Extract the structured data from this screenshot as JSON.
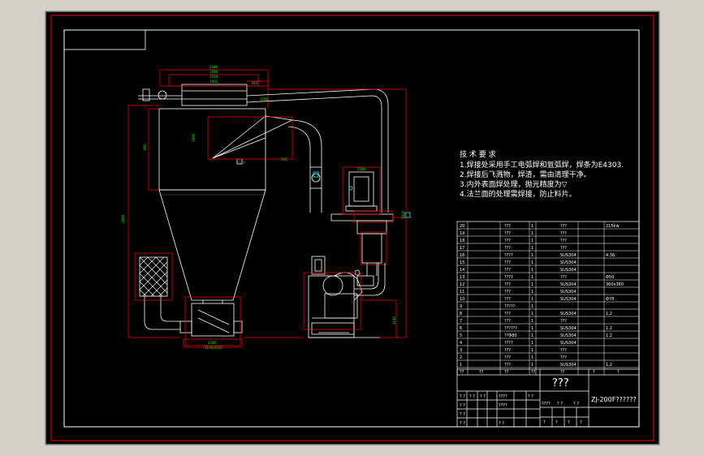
{
  "colors": {
    "frame_bg": "#d4d0c8",
    "canvas": "#000000",
    "outer_border": "#ff0000",
    "drawing_lines": "#ffffff",
    "dimension_lines": "#ff0000",
    "dimension_text": "#00ff00",
    "accent_cyan": "#00ffff"
  },
  "tech_requirements": {
    "heading": "技 术 要 求",
    "items": [
      "1.焊接处采用手工电弧焊和氩弧焊，焊条为E4303.",
      "2.焊接后飞溅物，焊渣，需由清理干净。",
      "3.内外表面焊处理，抛光精度为▽",
      "4.法兰面的处理需焊接，防止料片。"
    ]
  },
  "parts_table": {
    "rows": [
      {
        "no": "20",
        "code": "???",
        "name": "1",
        "material": "???",
        "note": "215kw"
      },
      {
        "no": "19",
        "code": "???",
        "name": "1",
        "material": "???",
        "note": ""
      },
      {
        "no": "18",
        "code": "???",
        "name": "1",
        "material": "???",
        "note": ""
      },
      {
        "no": "17",
        "code": "???",
        "name": "1",
        "material": "???",
        "note": ""
      },
      {
        "no": "16",
        "code": "????",
        "name": "1",
        "material": "SUS304",
        "note": "4.36"
      },
      {
        "no": "15",
        "code": "???",
        "name": "1",
        "material": "SUS304",
        "note": ""
      },
      {
        "no": "14",
        "code": "???",
        "name": "1",
        "material": "SUS304",
        "note": ""
      },
      {
        "no": "13",
        "code": "????",
        "name": "1",
        "material": "???",
        "note": "Φ50"
      },
      {
        "no": "12",
        "code": "???",
        "name": "1",
        "material": "SUS304",
        "note": "360x360"
      },
      {
        "no": "11",
        "code": "???",
        "name": "1",
        "material": "SUS304",
        "note": ""
      },
      {
        "no": "10",
        "code": "???",
        "name": "1",
        "material": "SUS304",
        "note": "Φ78"
      },
      {
        "no": "9",
        "code": "?????",
        "name": "1",
        "material": "",
        "note": ""
      },
      {
        "no": "8",
        "code": "???",
        "name": "1",
        "material": "SUS304",
        "note": "1.2"
      },
      {
        "no": "7",
        "code": "???",
        "name": "1",
        "material": "???",
        "note": ""
      },
      {
        "no": "6",
        "code": "??????",
        "name": "1",
        "material": "SUS304",
        "note": "1.2"
      },
      {
        "no": "5",
        "code": "??Φ80",
        "name": "1",
        "material": "SUS304",
        "note": "1.2"
      },
      {
        "no": "4",
        "code": "????",
        "name": "1",
        "material": "SUS304",
        "note": ""
      },
      {
        "no": "3",
        "code": "???",
        "name": "1",
        "material": "???",
        "note": ""
      },
      {
        "no": "2",
        "code": "???",
        "name": "1",
        "material": "???",
        "note": ""
      },
      {
        "no": "1",
        "code": "???",
        "name": "1",
        "material": "SUS304",
        "note": "1.2"
      }
    ],
    "header_row": [
      "??",
      "??",
      "??",
      "??",
      "??",
      "?",
      "?"
    ]
  },
  "title_block": {
    "drawing_title": "???",
    "drawing_code": "ZJ-200F??????",
    "sign_rows": [
      [
        "? ?",
        "? ?",
        "? ?",
        "????",
        "? ?"
      ],
      [
        "? ?",
        "",
        "????",
        ""
      ],
      [
        "? ?",
        "",
        "",
        ""
      ],
      [
        "? ?",
        "",
        "? ?",
        ""
      ]
    ],
    "scale_labels": [
      "????",
      "? ?",
      "? ?"
    ],
    "sheet_labels": [
      "?",
      "?",
      "?",
      "?",
      "?"
    ]
  },
  "dimension_labels": {
    "top_stack": [
      "2346",
      "1910",
      "1504",
      "1002"
    ],
    "left": [
      "2890",
      "880",
      "1890"
    ],
    "bottom": [
      "2345",
      "2166/3550"
    ],
    "right": [
      "1600",
      "1240"
    ],
    "misc": [
      "810",
      "545",
      "310",
      "1260",
      "2548"
    ]
  }
}
